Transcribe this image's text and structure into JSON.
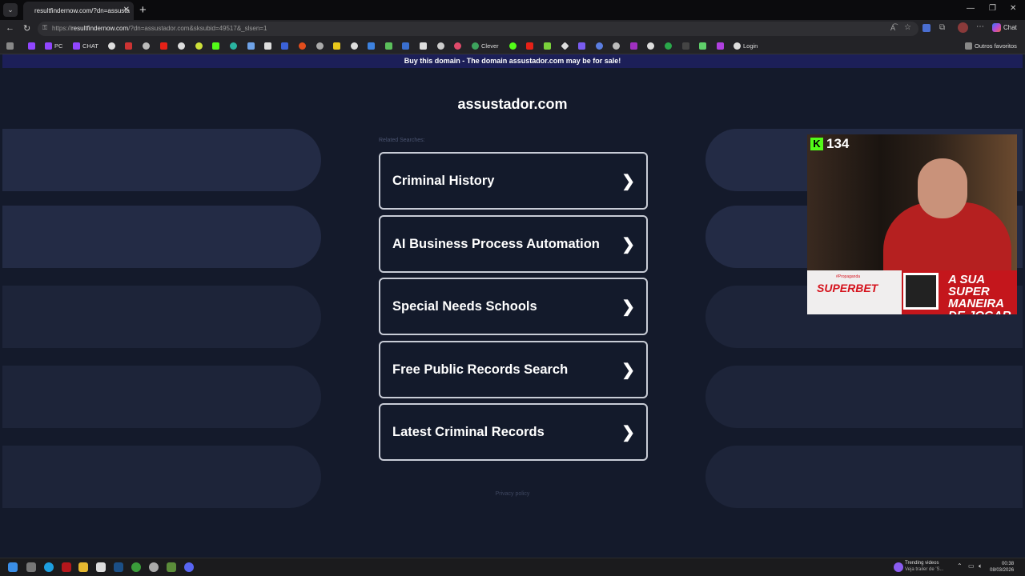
{
  "browser": {
    "tab_title": "resultfindernow.com/?dn=assusta",
    "tab_close": "✕",
    "new_tab": "+",
    "url_host": "resultfindernow.com",
    "url_prefix": "https://",
    "url_path": "/?dn=assustador.com&sksubid=49517&_slsen=1",
    "chat_label": "Chat"
  },
  "bookmarks": {
    "pc": "PC",
    "chat": "CHAT",
    "clever": "Clever",
    "login": "Login",
    "others": "Outros favoritos"
  },
  "page": {
    "banner": "Buy this domain - The domain assustador.com may be for sale!",
    "domain": "assustador.com",
    "related_label": "Related Searches:",
    "items": [
      {
        "label": "Criminal History"
      },
      {
        "label": "AI Business Process Automation"
      },
      {
        "label": "Special Needs Schools"
      },
      {
        "label": "Free Public Records Search"
      },
      {
        "label": "Latest Criminal Records"
      }
    ],
    "privacy": "Privacy policy"
  },
  "overlay": {
    "viewer_count": "134",
    "kick_letter": "K",
    "ad_brand": "SUPERBET",
    "ad_tag": "#Propaganda",
    "ad_slogan": "A SUA SUPER MANEIRA DE JOGAR"
  },
  "taskbar": {
    "trending_title": "Trending videos",
    "trending_sub": "Veja trailer de 'S...",
    "time": "00:38",
    "date": "08/03/2026"
  },
  "colors": {
    "page_bg": "#141a2b",
    "banner_bg": "#1c1f58",
    "kick_green": "#53fc18",
    "superbet_red": "#c4161c"
  }
}
